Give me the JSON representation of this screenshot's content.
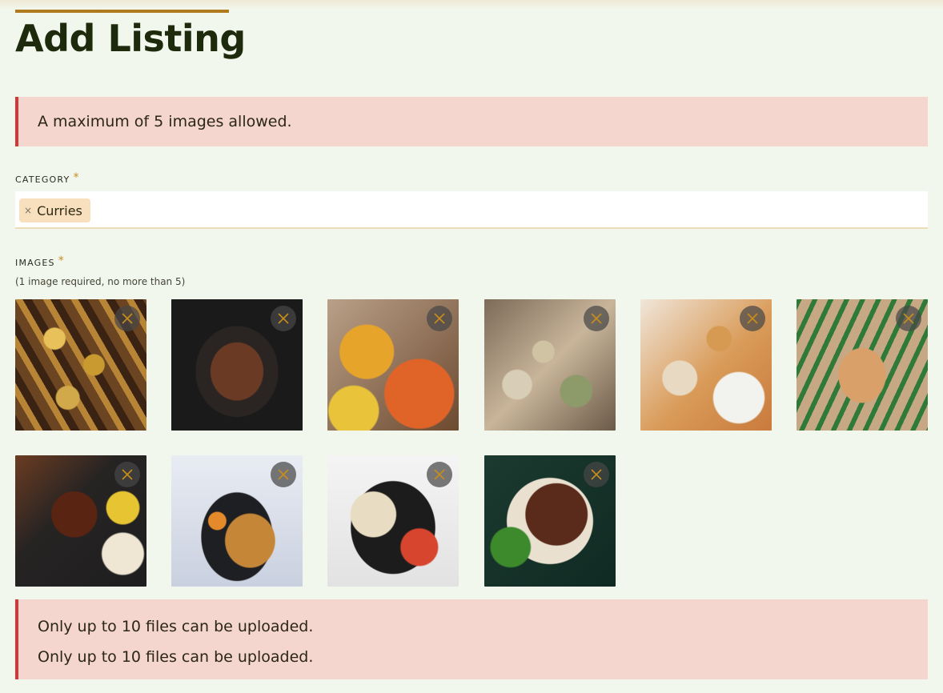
{
  "page": {
    "title": "Add Listing"
  },
  "alerts": {
    "top_message": "A maximum of 5 images allowed.",
    "bottom_messages": [
      "Only up to 10 files can be uploaded.",
      "Only up to 10 files can be uploaded."
    ]
  },
  "category": {
    "label": "CATEGORY",
    "required_mark": "*",
    "selected_tags": [
      {
        "label": "Curries",
        "remove_symbol": "×"
      }
    ]
  },
  "images": {
    "label": "IMAGES",
    "required_mark": "*",
    "helper_text": "(1 image required, no more than 5)",
    "thumbnails": [
      {
        "icon": "remove-icon"
      },
      {
        "icon": "remove-icon"
      },
      {
        "icon": "remove-icon"
      },
      {
        "icon": "remove-icon"
      },
      {
        "icon": "remove-icon"
      },
      {
        "icon": "remove-icon"
      },
      {
        "icon": "remove-icon"
      },
      {
        "icon": "remove-icon"
      },
      {
        "icon": "remove-icon"
      },
      {
        "icon": "remove-icon"
      }
    ]
  },
  "colors": {
    "background": "#f2f7ee",
    "accent": "#b07a1e",
    "title": "#1d2a0c",
    "alert_background": "#f4d6cf",
    "alert_border": "#d1383a",
    "tag_background": "#f8dfbd",
    "required_mark": "#c98d1c",
    "remove_icon": "#c98d1c"
  }
}
